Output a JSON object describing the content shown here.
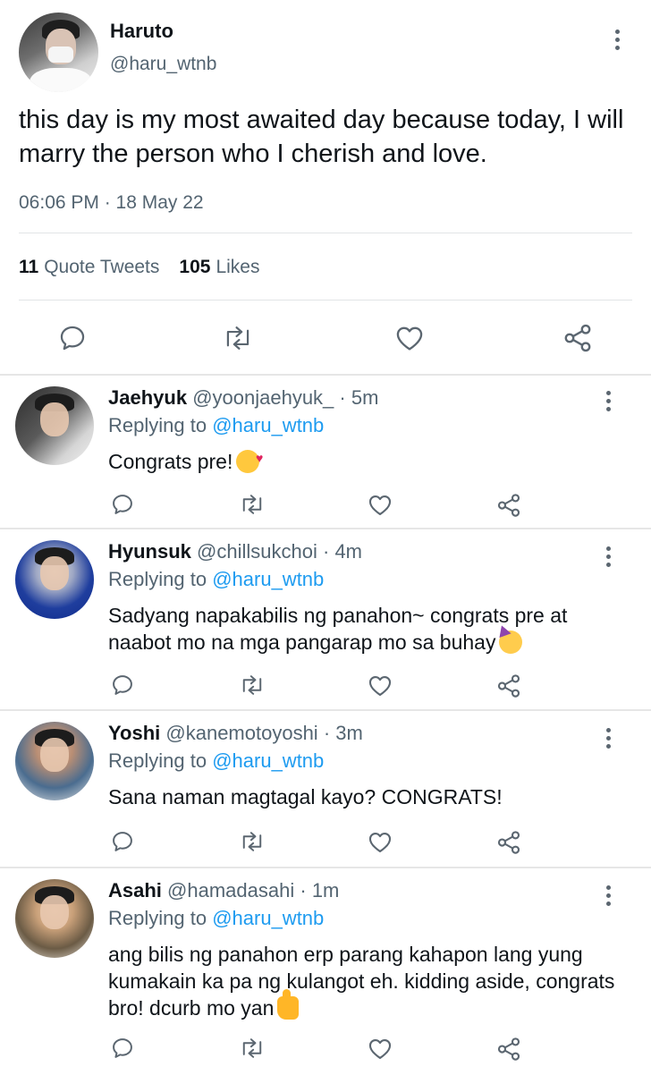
{
  "main_tweet": {
    "name": "Haruto",
    "handle": "@haru_wtnb",
    "text": "this day is my most awaited day because today, I will marry the person who I cherish and love.",
    "timestamp": "06:06 PM · 18 May 22",
    "quote_count": "11",
    "quote_label": "Quote Tweets",
    "like_count": "105",
    "like_label": "Likes",
    "actions": [
      "reply-icon",
      "retweet-icon",
      "like-icon",
      "share-icon"
    ]
  },
  "replies": [
    {
      "name": "Jaehyuk",
      "handle": "@yoonjaehyuk_",
      "time": "· 5m",
      "replying_prefix": "Replying to",
      "replying_to": "@haru_wtnb",
      "text": "Congrats pre!",
      "emoji": "smiling-face-with-hearts-emoji"
    },
    {
      "name": "Hyunsuk",
      "handle": "@chillsukchoi",
      "time": "· 4m",
      "replying_prefix": "Replying to",
      "replying_to": "@haru_wtnb",
      "text": "Sadyang napakabilis ng panahon~ congrats pre at naabot mo na mga pangarap mo sa buhay",
      "emoji": "partying-face-emoji"
    },
    {
      "name": "Yoshi",
      "handle": "@kanemotoyoshi",
      "time": "· 3m",
      "replying_prefix": "Replying to",
      "replying_to": "@haru_wtnb",
      "text": "Sana naman magtagal kayo? CONGRATS!"
    },
    {
      "name": "Asahi",
      "handle": "@hamadasahi",
      "time": "· 1m",
      "replying_prefix": "Replying to",
      "replying_to": "@haru_wtnb",
      "text": "ang bilis ng panahon erp parang kahapon lang yung kumakain ka pa ng kulangot eh. kidding aside, congrats bro! dcurb mo yan",
      "emoji": "thumbs-up-emoji"
    }
  ],
  "colors": {
    "text": "#0f1419",
    "secondary": "#536471",
    "link": "#1d9bf0",
    "divider": "#e6e6e6",
    "icon": "#5b6670"
  }
}
